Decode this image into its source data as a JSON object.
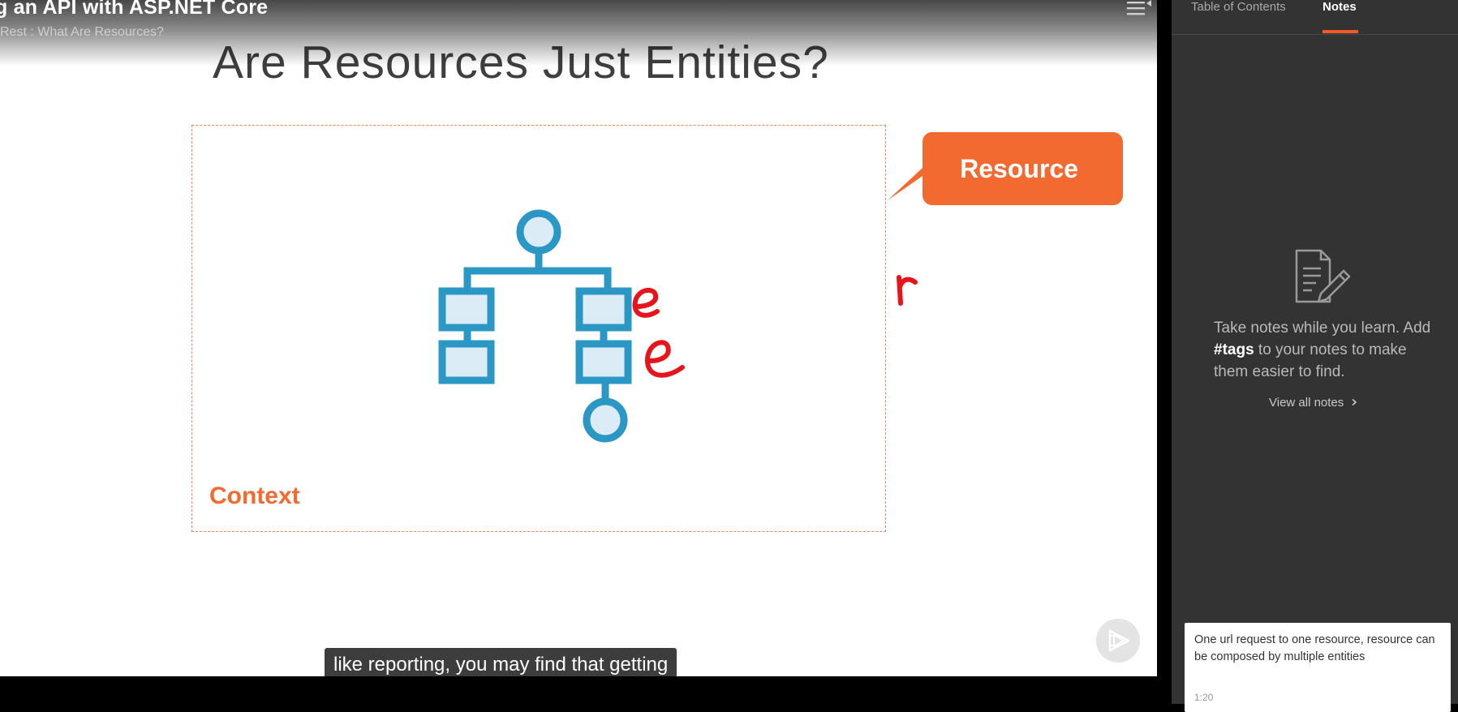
{
  "player": {
    "course_title": "g an API with ASP.NET Core",
    "module_title": "Rest : What Are Resources?",
    "playlist_icon": "playlist-icon",
    "caption": "like reporting, you may find that getting",
    "logo_icon": "play-logo-icon"
  },
  "slide": {
    "title": "Are Resources Just Entities?",
    "context_label": "Context",
    "callout_label": "Resource",
    "handwriting": [
      "e",
      "e",
      "r"
    ],
    "accent_color": "#f26a30",
    "diagram_color": "#2b97c4",
    "ink_color": "#e8141c"
  },
  "panel": {
    "tabs": [
      {
        "label": "Table of Contents",
        "active": false
      },
      {
        "label": "Notes",
        "active": true
      }
    ],
    "empty_state": {
      "icon": "note-edit-icon",
      "line1": "Take notes while you learn.",
      "add": "Add ",
      "tag": "#tags",
      "rest": " to your notes to make them easier to find.",
      "link": "View all notes"
    },
    "note": {
      "text": "One url request to one resource, resource can be composed by multiple entities",
      "time": "1:20"
    },
    "accent_color": "#f05a28"
  }
}
